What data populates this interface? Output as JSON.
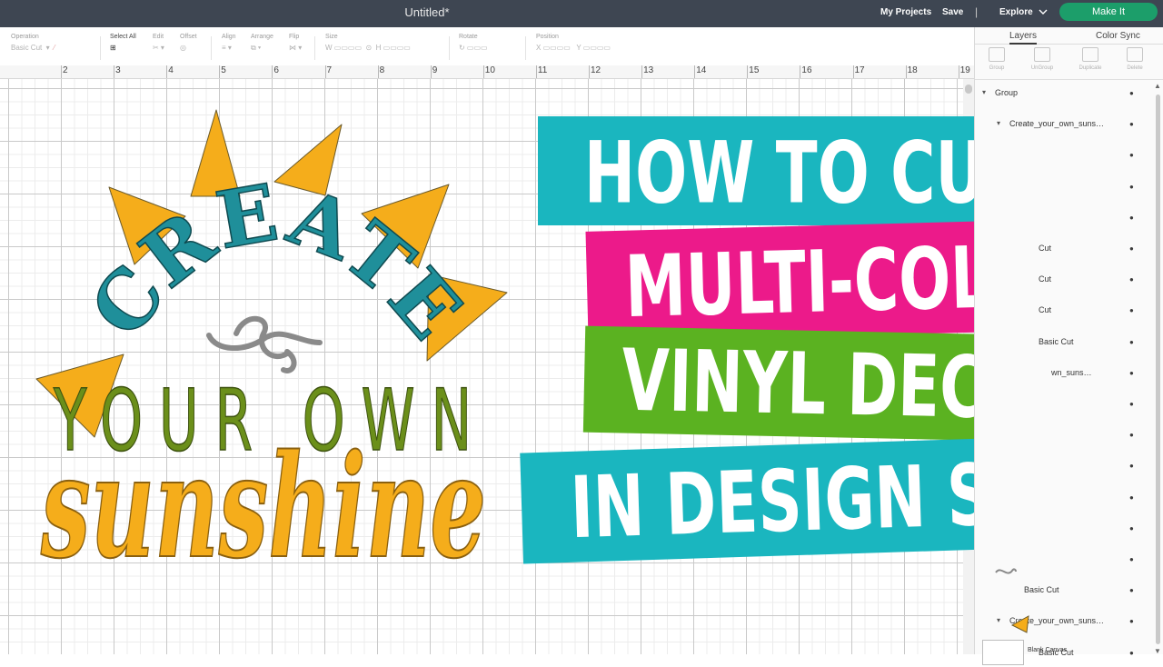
{
  "topbar": {
    "title": "Untitled*",
    "my_projects": "My Projects",
    "save": "Save",
    "separator": "|",
    "explore": "Explore",
    "make_it": "Make It"
  },
  "toolbar": {
    "operation_label": "Operation",
    "operation_value": "Basic Cut",
    "select_all": "Select All",
    "edit": "Edit",
    "offset": "Offset",
    "align": "Align",
    "arrange": "Arrange",
    "flip": "Flip",
    "size": "Size",
    "size_w": "W",
    "size_h": "H",
    "rotate": "Rotate",
    "position": "Position",
    "pos_x": "X",
    "pos_y": "Y"
  },
  "ruler": [
    "2",
    "3",
    "4",
    "5",
    "6",
    "7",
    "8",
    "9",
    "10",
    "11",
    "12",
    "13",
    "14",
    "15",
    "16",
    "17",
    "18",
    "19"
  ],
  "panel": {
    "tabs": [
      "Layers",
      "Color Sync"
    ],
    "tools": [
      "Group",
      "UnGroup",
      "Duplicate",
      "Delete"
    ],
    "layers": [
      {
        "name": "Group",
        "caret": "▾"
      },
      {
        "name": "Create_your_own_suns…",
        "caret": "▾"
      },
      {
        "name": "",
        "caret": ""
      },
      {
        "name": "",
        "caret": ""
      },
      {
        "name": "",
        "caret": ""
      },
      {
        "name": "Cut",
        "caret": ""
      },
      {
        "name": "Cut",
        "caret": ""
      },
      {
        "name": "Cut",
        "caret": ""
      },
      {
        "name": "Basic Cut",
        "caret": ""
      },
      {
        "name": "wn_suns…",
        "caret": ""
      },
      {
        "name": "",
        "caret": ""
      },
      {
        "name": "",
        "caret": ""
      },
      {
        "name": "",
        "caret": ""
      },
      {
        "name": "",
        "caret": ""
      },
      {
        "name": "",
        "caret": ""
      },
      {
        "name": "",
        "caret": ""
      },
      {
        "name": "Basic Cut",
        "caret": ""
      },
      {
        "name": "Create_your_own_suns…",
        "caret": "▾"
      },
      {
        "name": "Basic Cut",
        "caret": ""
      }
    ],
    "blank_canvas": "Blank Canvas"
  },
  "design": {
    "word_create": "CREATE",
    "word_your_own": "YOUR OWN",
    "word_sunshine": "sunshine"
  },
  "banners": {
    "line1": "HOW TO CUT A",
    "line2": "MULTI-COLOR",
    "line3": "VINYL DECAL",
    "line4": "IN DESIGN SPACE"
  },
  "colors": {
    "topbar": "#3e4652",
    "make_it": "#1c9e6a",
    "teal": "#1ab6bf",
    "pink": "#ec1a8a",
    "green": "#5bb221",
    "ray": "#f5ad1b",
    "create_teal": "#1f8f9a",
    "your_own_green": "#5d7e16",
    "swirl_gray": "#8a8a8a"
  }
}
